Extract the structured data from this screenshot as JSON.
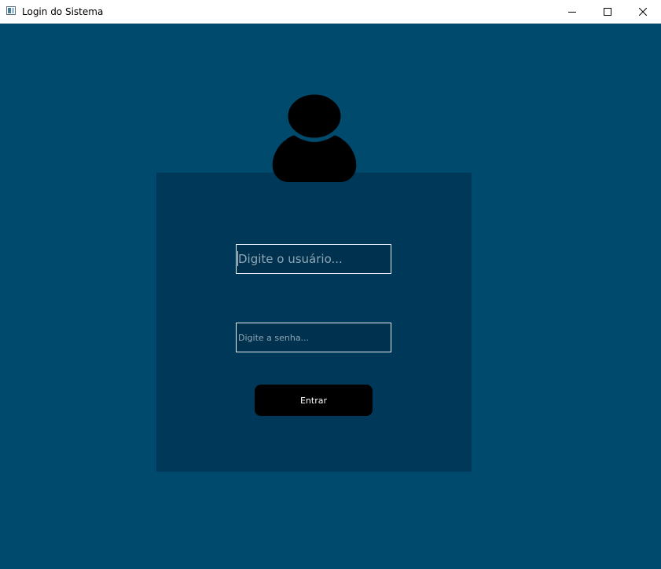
{
  "window": {
    "title": "Login do Sistema",
    "icon": "app-window-icon",
    "controls": {
      "minimize": "minimize-icon",
      "maximize": "maximize-icon",
      "close": "close-icon"
    }
  },
  "colors": {
    "background": "#004a6e",
    "card": "#00385a",
    "field_bg": "#00324f",
    "field_border": "#e6eef3",
    "button_bg": "#000000",
    "button_text": "#ffffff"
  },
  "login": {
    "avatar_icon": "user-avatar-icon",
    "username": {
      "value": "",
      "placeholder": "Digite o usuário..."
    },
    "password": {
      "value": "",
      "placeholder": "Digite a senha..."
    },
    "submit_label": "Entrar"
  }
}
